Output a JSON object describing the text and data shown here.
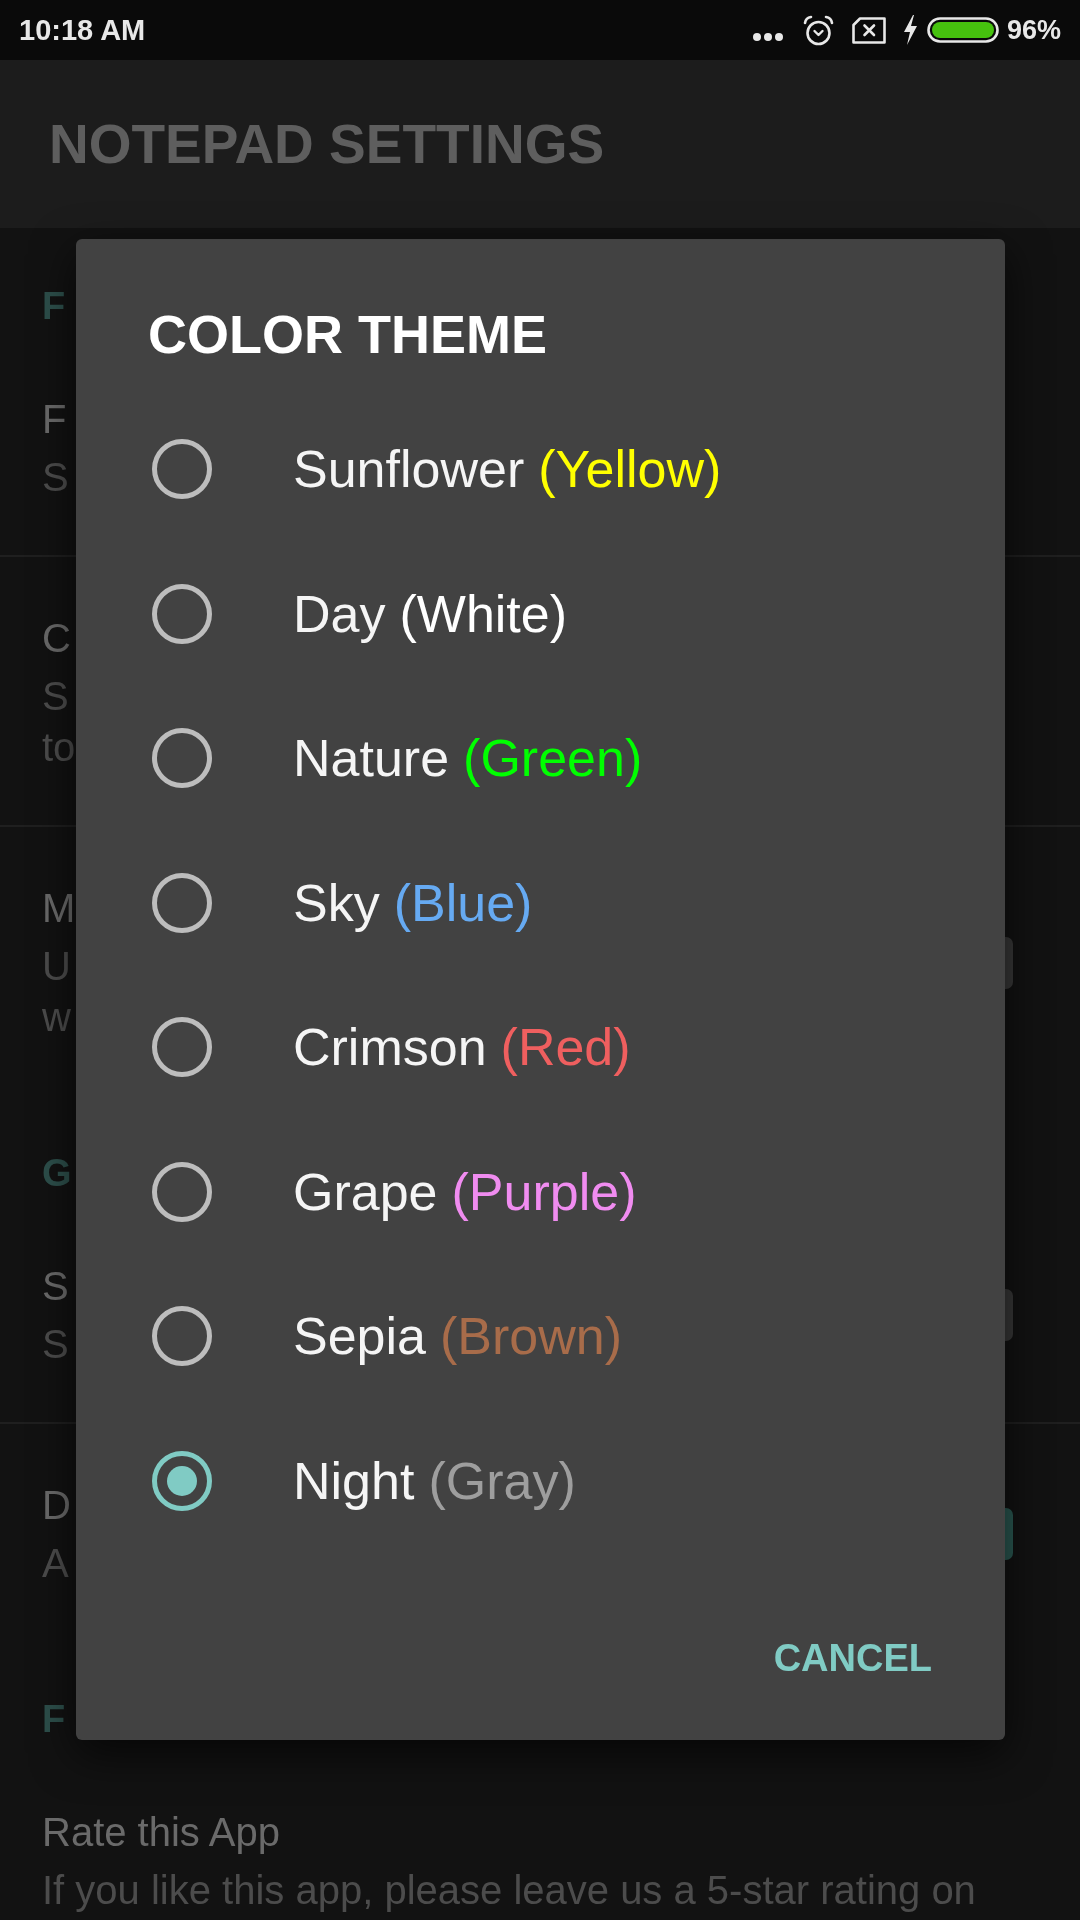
{
  "status_bar": {
    "time": "10:18 AM",
    "battery": "96%"
  },
  "app_bar": {
    "title": "NOTEPAD SETTINGS"
  },
  "settings": [
    {
      "header": "F",
      "items": [
        {
          "title": "F",
          "subtitle": [
            "S"
          ]
        },
        {
          "title": "C",
          "subtitle": [
            "S",
            "to"
          ]
        },
        {
          "title": "M",
          "subtitle": [
            "U",
            "w"
          ],
          "switch": {
            "on": false
          }
        }
      ]
    },
    {
      "header": "G",
      "items": [
        {
          "title": "S",
          "subtitle": [
            "S"
          ],
          "switch": {
            "on": false
          }
        },
        {
          "title": "D",
          "subtitle": [
            "A"
          ],
          "switch": {
            "on": true
          }
        }
      ]
    },
    {
      "header": "F",
      "items": [
        {
          "title": "Rate this App",
          "subtitle": [
            "If you like this app, please leave us a 5-star rating on"
          ]
        }
      ]
    }
  ],
  "dialog": {
    "title": "COLOR THEME",
    "options": [
      {
        "name": "Sunflower",
        "color_name": "(Yellow)",
        "color": "#ffff00",
        "selected": false
      },
      {
        "name": "Day",
        "color_name": "(White)",
        "color": "#ffffff",
        "selected": false
      },
      {
        "name": "Nature",
        "color_name": "(Green)",
        "color": "#00ff00",
        "selected": false
      },
      {
        "name": "Sky",
        "color_name": "(Blue)",
        "color": "#66aaf2",
        "selected": false
      },
      {
        "name": "Crimson",
        "color_name": "(Red)",
        "color": "#ef5f5f",
        "selected": false
      },
      {
        "name": "Grape",
        "color_name": "(Purple)",
        "color": "#f08cf0",
        "selected": false
      },
      {
        "name": "Sepia",
        "color_name": "(Brown)",
        "color": "#a86c4a",
        "selected": false
      },
      {
        "name": "Night",
        "color_name": "(Gray)",
        "color": "#9e9e9e",
        "selected": true
      }
    ],
    "buttons": [
      "CANCEL"
    ]
  }
}
